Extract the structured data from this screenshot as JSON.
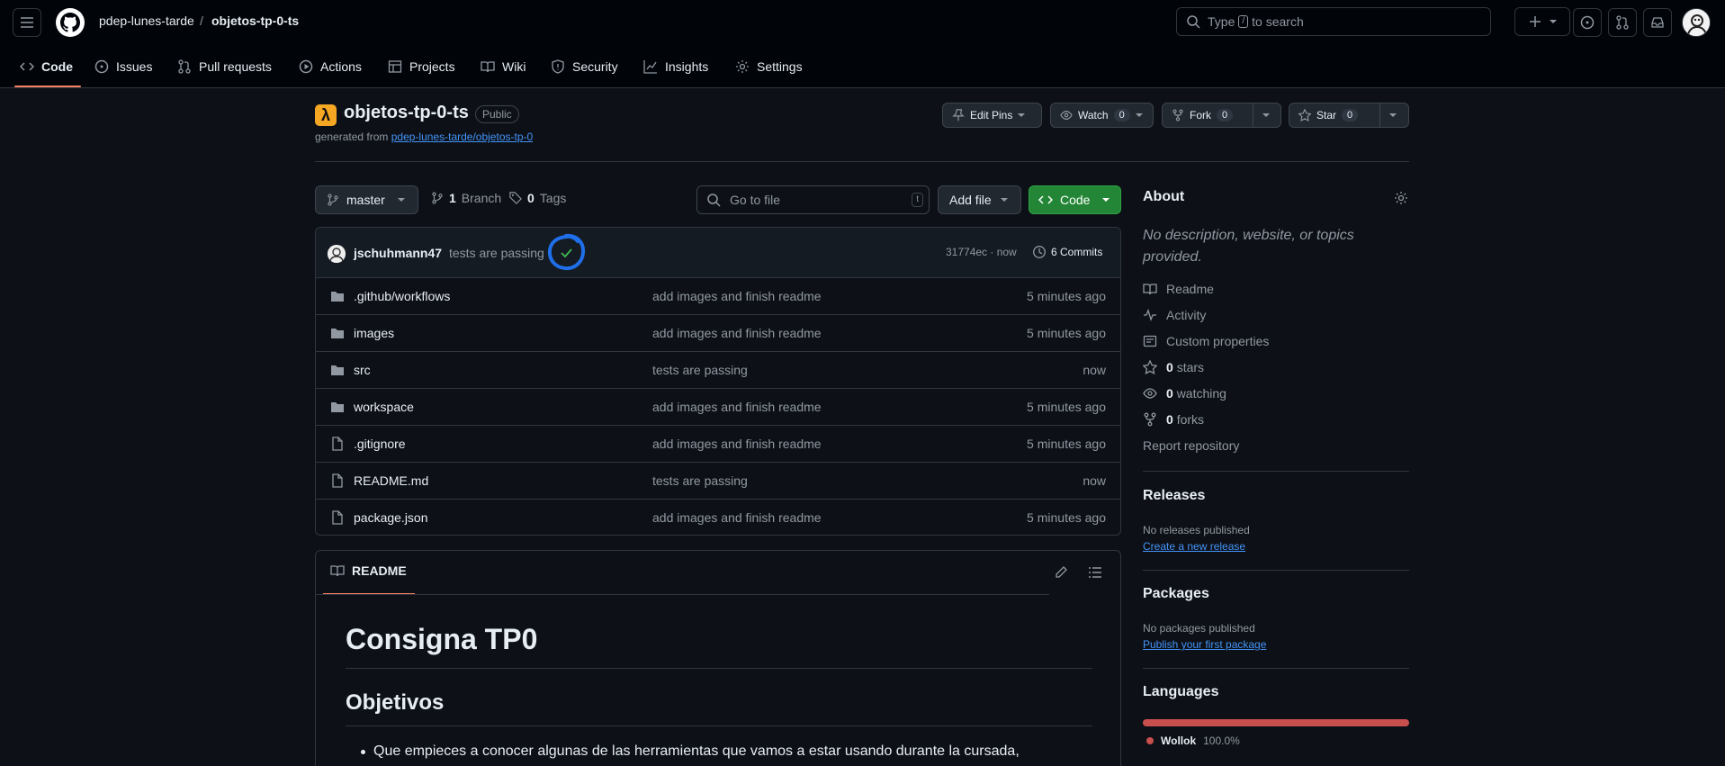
{
  "header": {
    "owner": "pdep-lunes-tarde",
    "separator": "/",
    "repo": "objetos-tp-0-ts",
    "search_pre": "Type",
    "search_key": "/",
    "search_post": "to search"
  },
  "tabs": [
    {
      "label": "Code",
      "icon": "code-icon"
    },
    {
      "label": "Issues",
      "icon": "issue-icon"
    },
    {
      "label": "Pull requests",
      "icon": "pull-request-icon"
    },
    {
      "label": "Actions",
      "icon": "play-icon"
    },
    {
      "label": "Projects",
      "icon": "table-icon"
    },
    {
      "label": "Wiki",
      "icon": "book-icon"
    },
    {
      "label": "Security",
      "icon": "shield-icon"
    },
    {
      "label": "Insights",
      "icon": "graph-icon"
    },
    {
      "label": "Settings",
      "icon": "gear-icon"
    }
  ],
  "repo": {
    "name": "objetos-tp-0-ts",
    "visibility": "Public",
    "generated_prefix": "generated from",
    "generated_link": "pdep-lunes-tarde/objetos-tp-0",
    "icon_glyph": "λ"
  },
  "actions": {
    "edit_pins": "Edit Pins",
    "watch": "Watch",
    "watch_count": "0",
    "fork": "Fork",
    "fork_count": "0",
    "star": "Star",
    "star_count": "0"
  },
  "branch": {
    "name": "master",
    "branch_count": "1",
    "branch_label": "Branch",
    "tag_count": "0",
    "tag_label": "Tags",
    "goto_placeholder": "Go to file",
    "goto_key": "t",
    "add_file": "Add file",
    "code": "Code"
  },
  "commit": {
    "user": "jschuhmann47",
    "message": "tests are passing",
    "hash_time": "31774ec · now",
    "commits_label": "6 Commits"
  },
  "files": [
    {
      "type": "folder",
      "name": ".github/workflows",
      "message": "add images and finish readme",
      "time": "5 minutes ago"
    },
    {
      "type": "folder",
      "name": "images",
      "message": "add images and finish readme",
      "time": "5 minutes ago"
    },
    {
      "type": "folder",
      "name": "src",
      "message": "tests are passing",
      "time": "now"
    },
    {
      "type": "folder",
      "name": "workspace",
      "message": "add images and finish readme",
      "time": "5 minutes ago"
    },
    {
      "type": "file",
      "name": ".gitignore",
      "message": "add images and finish readme",
      "time": "5 minutes ago"
    },
    {
      "type": "file",
      "name": "README.md",
      "message": "tests are passing",
      "time": "now"
    },
    {
      "type": "file",
      "name": "package.json",
      "message": "add images and finish readme",
      "time": "5 minutes ago"
    }
  ],
  "readme": {
    "tab": "README",
    "h1": "Consigna TP0",
    "h2": "Objetivos",
    "bullet": "Que empieces a conocer algunas de las herramientas que vamos a estar usando durante la cursada,"
  },
  "about": {
    "title": "About",
    "description": "No description, website, or topics provided.",
    "readme": "Readme",
    "activity": "Activity",
    "custom_properties": "Custom properties",
    "stars_count": "0",
    "stars_label": "stars",
    "watching_count": "0",
    "watching_label": "watching",
    "forks_count": "0",
    "forks_label": "forks",
    "report": "Report repository"
  },
  "releases": {
    "title": "Releases",
    "none": "No releases published",
    "create": "Create a new release"
  },
  "packages": {
    "title": "Packages",
    "none": "No packages published",
    "publish": "Publish your first package"
  },
  "languages": {
    "title": "Languages",
    "items": [
      {
        "name": "Wollok",
        "percent": "100.0%",
        "share": 1.0,
        "color": "#c94e4e"
      }
    ]
  },
  "colors": {
    "accent_underline": "#f78166",
    "code_button": "#238636",
    "link": "#4493f8",
    "annotation": "#1f6feb"
  }
}
